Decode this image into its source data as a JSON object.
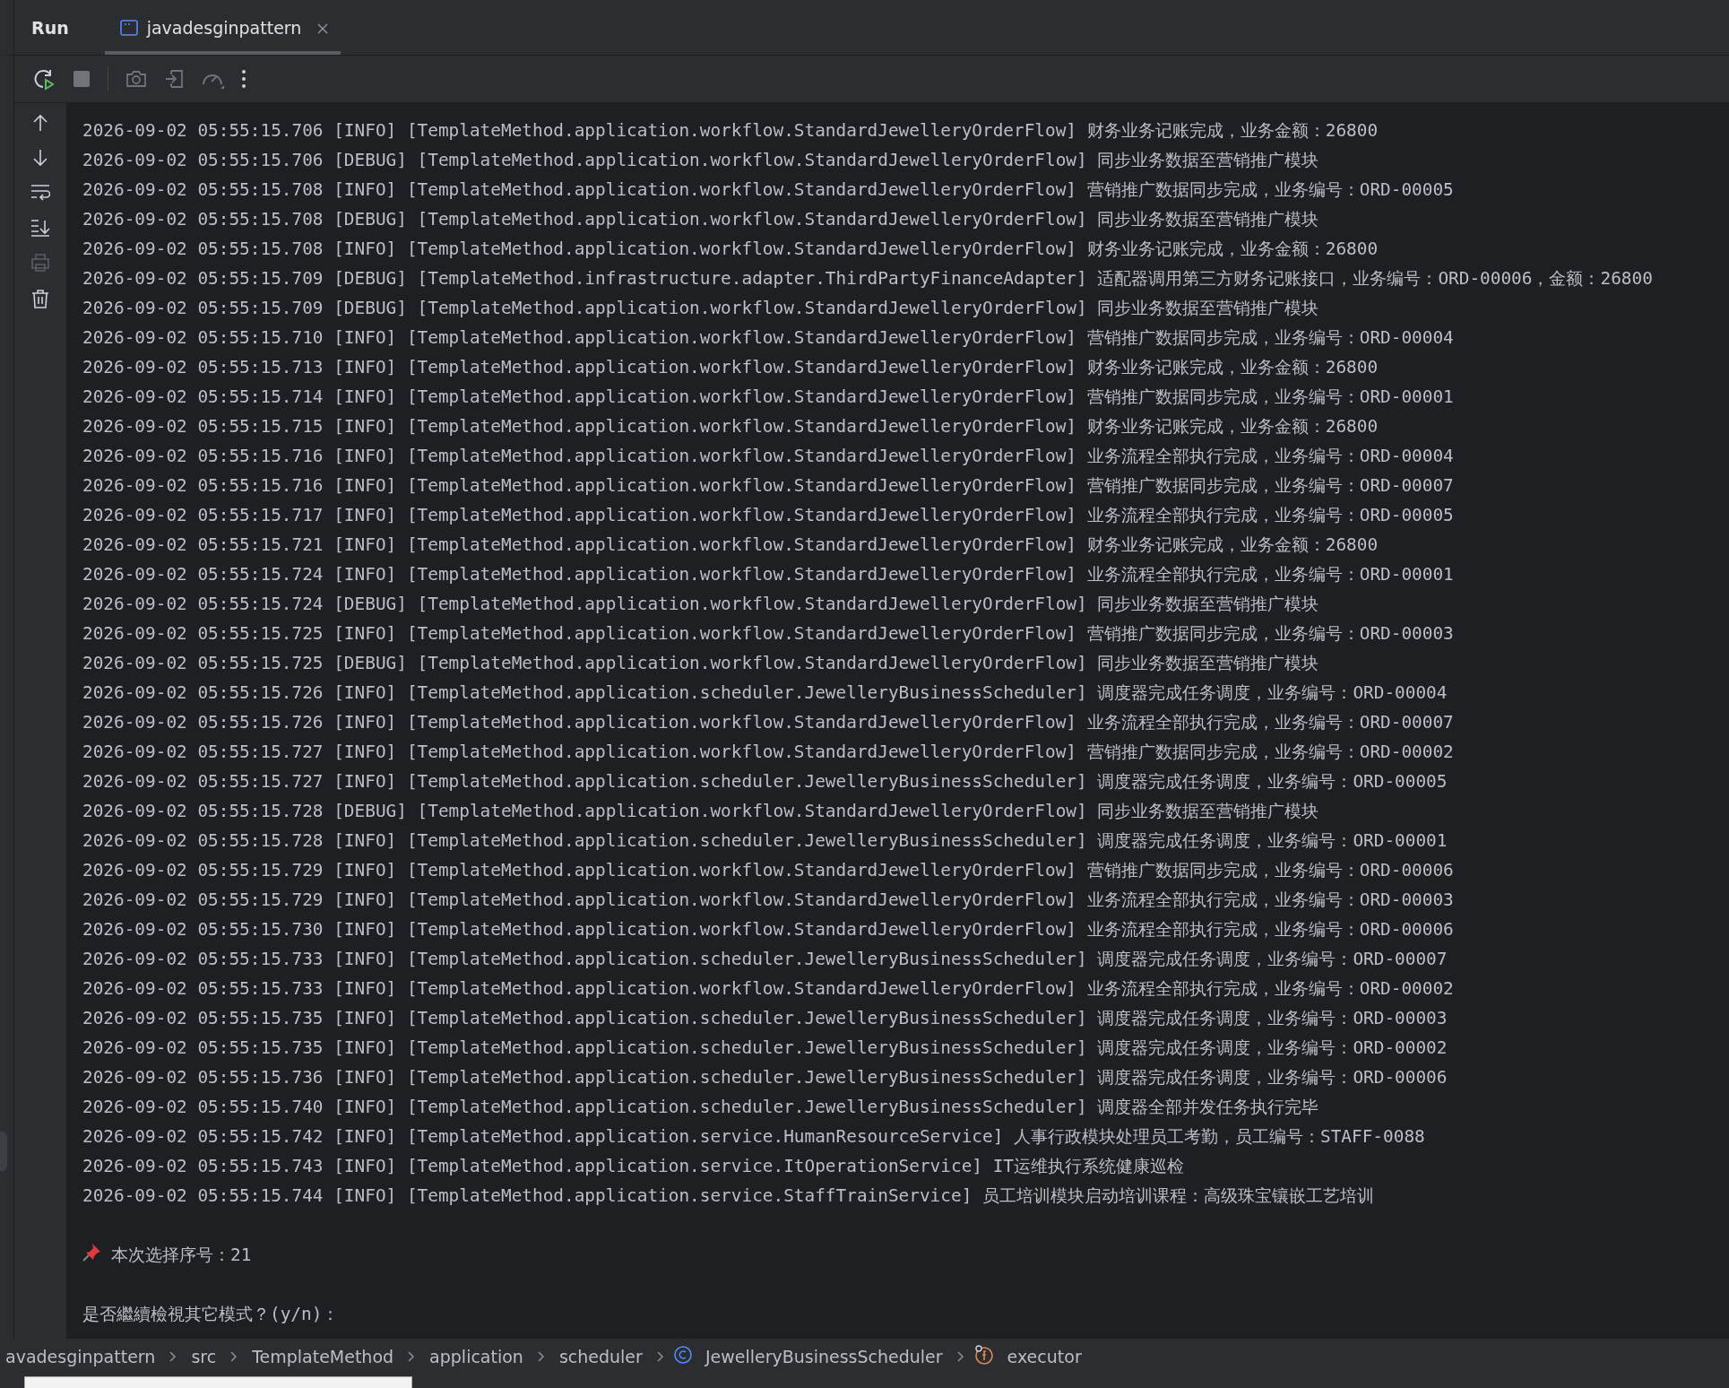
{
  "tool_window": {
    "title": "Run",
    "tabs": [
      {
        "label": "javadesginpattern",
        "selected": true
      }
    ]
  },
  "log_lines": [
    "2026-09-02 05:55:15.706 [INFO] [TemplateMethod.application.workflow.StandardJewelleryOrderFlow] 财务业务记账完成，业务金额：26800",
    "2026-09-02 05:55:15.706 [DEBUG] [TemplateMethod.application.workflow.StandardJewelleryOrderFlow] 同步业务数据至营销推广模块",
    "2026-09-02 05:55:15.708 [INFO] [TemplateMethod.application.workflow.StandardJewelleryOrderFlow] 营销推广数据同步完成，业务编号：ORD-00005",
    "2026-09-02 05:55:15.708 [DEBUG] [TemplateMethod.application.workflow.StandardJewelleryOrderFlow] 同步业务数据至营销推广模块",
    "2026-09-02 05:55:15.708 [INFO] [TemplateMethod.application.workflow.StandardJewelleryOrderFlow] 财务业务记账完成，业务金额：26800",
    "2026-09-02 05:55:15.709 [DEBUG] [TemplateMethod.infrastructure.adapter.ThirdPartyFinanceAdapter] 适配器调用第三方财务记账接口，业务编号：ORD-00006，金额：26800",
    "2026-09-02 05:55:15.709 [DEBUG] [TemplateMethod.application.workflow.StandardJewelleryOrderFlow] 同步业务数据至营销推广模块",
    "2026-09-02 05:55:15.710 [INFO] [TemplateMethod.application.workflow.StandardJewelleryOrderFlow] 营销推广数据同步完成，业务编号：ORD-00004",
    "2026-09-02 05:55:15.713 [INFO] [TemplateMethod.application.workflow.StandardJewelleryOrderFlow] 财务业务记账完成，业务金额：26800",
    "2026-09-02 05:55:15.714 [INFO] [TemplateMethod.application.workflow.StandardJewelleryOrderFlow] 营销推广数据同步完成，业务编号：ORD-00001",
    "2026-09-02 05:55:15.715 [INFO] [TemplateMethod.application.workflow.StandardJewelleryOrderFlow] 财务业务记账完成，业务金额：26800",
    "2026-09-02 05:55:15.716 [INFO] [TemplateMethod.application.workflow.StandardJewelleryOrderFlow] 业务流程全部执行完成，业务编号：ORD-00004",
    "2026-09-02 05:55:15.716 [INFO] [TemplateMethod.application.workflow.StandardJewelleryOrderFlow] 营销推广数据同步完成，业务编号：ORD-00007",
    "2026-09-02 05:55:15.717 [INFO] [TemplateMethod.application.workflow.StandardJewelleryOrderFlow] 业务流程全部执行完成，业务编号：ORD-00005",
    "2026-09-02 05:55:15.721 [INFO] [TemplateMethod.application.workflow.StandardJewelleryOrderFlow] 财务业务记账完成，业务金额：26800",
    "2026-09-02 05:55:15.724 [INFO] [TemplateMethod.application.workflow.StandardJewelleryOrderFlow] 业务流程全部执行完成，业务编号：ORD-00001",
    "2026-09-02 05:55:15.724 [DEBUG] [TemplateMethod.application.workflow.StandardJewelleryOrderFlow] 同步业务数据至营销推广模块",
    "2026-09-02 05:55:15.725 [INFO] [TemplateMethod.application.workflow.StandardJewelleryOrderFlow] 营销推广数据同步完成，业务编号：ORD-00003",
    "2026-09-02 05:55:15.725 [DEBUG] [TemplateMethod.application.workflow.StandardJewelleryOrderFlow] 同步业务数据至营销推广模块",
    "2026-09-02 05:55:15.726 [INFO] [TemplateMethod.application.scheduler.JewelleryBusinessScheduler] 调度器完成任务调度，业务编号：ORD-00004",
    "2026-09-02 05:55:15.726 [INFO] [TemplateMethod.application.workflow.StandardJewelleryOrderFlow] 业务流程全部执行完成，业务编号：ORD-00007",
    "2026-09-02 05:55:15.727 [INFO] [TemplateMethod.application.workflow.StandardJewelleryOrderFlow] 营销推广数据同步完成，业务编号：ORD-00002",
    "2026-09-02 05:55:15.727 [INFO] [TemplateMethod.application.scheduler.JewelleryBusinessScheduler] 调度器完成任务调度，业务编号：ORD-00005",
    "2026-09-02 05:55:15.728 [DEBUG] [TemplateMethod.application.workflow.StandardJewelleryOrderFlow] 同步业务数据至营销推广模块",
    "2026-09-02 05:55:15.728 [INFO] [TemplateMethod.application.scheduler.JewelleryBusinessScheduler] 调度器完成任务调度，业务编号：ORD-00001",
    "2026-09-02 05:55:15.729 [INFO] [TemplateMethod.application.workflow.StandardJewelleryOrderFlow] 营销推广数据同步完成，业务编号：ORD-00006",
    "2026-09-02 05:55:15.729 [INFO] [TemplateMethod.application.workflow.StandardJewelleryOrderFlow] 业务流程全部执行完成，业务编号：ORD-00003",
    "2026-09-02 05:55:15.730 [INFO] [TemplateMethod.application.workflow.StandardJewelleryOrderFlow] 业务流程全部执行完成，业务编号：ORD-00006",
    "2026-09-02 05:55:15.733 [INFO] [TemplateMethod.application.scheduler.JewelleryBusinessScheduler] 调度器完成任务调度，业务编号：ORD-00007",
    "2026-09-02 05:55:15.733 [INFO] [TemplateMethod.application.workflow.StandardJewelleryOrderFlow] 业务流程全部执行完成，业务编号：ORD-00002",
    "2026-09-02 05:55:15.735 [INFO] [TemplateMethod.application.scheduler.JewelleryBusinessScheduler] 调度器完成任务调度，业务编号：ORD-00003",
    "2026-09-02 05:55:15.735 [INFO] [TemplateMethod.application.scheduler.JewelleryBusinessScheduler] 调度器完成任务调度，业务编号：ORD-00002",
    "2026-09-02 05:55:15.736 [INFO] [TemplateMethod.application.scheduler.JewelleryBusinessScheduler] 调度器完成任务调度，业务编号：ORD-00006",
    "2026-09-02 05:55:15.740 [INFO] [TemplateMethod.application.scheduler.JewelleryBusinessScheduler] 调度器全部并发任务执行完毕",
    "2026-09-02 05:55:15.742 [INFO] [TemplateMethod.application.service.HumanResourceService] 人事行政模块处理员工考勤，员工编号：STAFF-0088",
    "2026-09-02 05:55:15.743 [INFO] [TemplateMethod.application.service.ItOperationService] IT运维执行系统健康巡检",
    "2026-09-02 05:55:15.744 [INFO] [TemplateMethod.application.service.StaffTrainService] 员工培训模块启动培训课程：高级珠宝镶嵌工艺培训"
  ],
  "prompt_lines": [
    {
      "kind": "pin",
      "text": "本次选择序号：21"
    },
    {
      "kind": "plain",
      "text": "是否繼續檢視其它模式？(y/n)："
    }
  ],
  "breadcrumbs": [
    {
      "kind": "plain",
      "label": "avadesginpattern"
    },
    {
      "kind": "plain",
      "label": "src"
    },
    {
      "kind": "plain",
      "label": "TemplateMethod"
    },
    {
      "kind": "plain",
      "label": "application"
    },
    {
      "kind": "plain",
      "label": "scheduler"
    },
    {
      "kind": "class",
      "label": "JewelleryBusinessScheduler"
    },
    {
      "kind": "field",
      "label": "executor"
    }
  ]
}
